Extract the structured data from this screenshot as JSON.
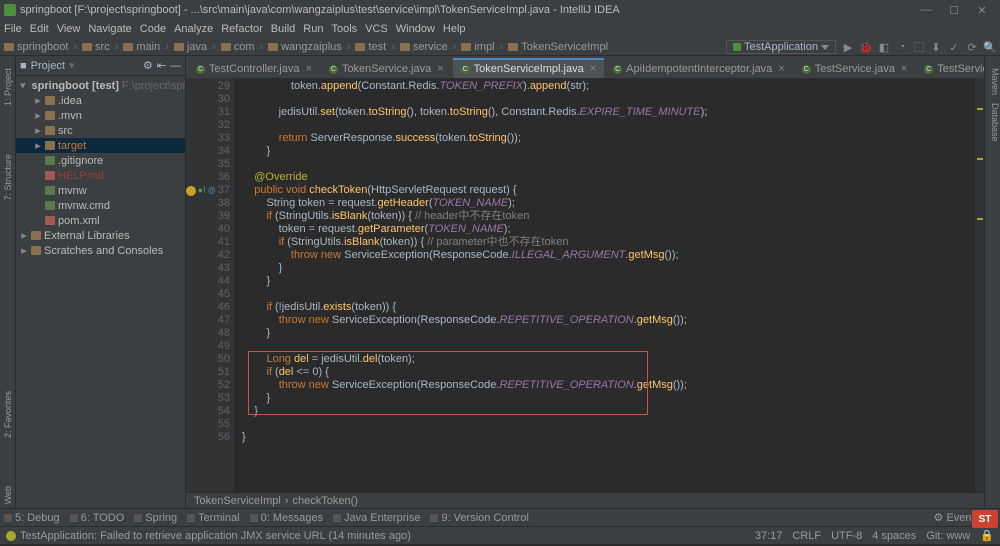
{
  "title": "springboot [F:\\project\\springboot] - ...\\src\\main\\java\\com\\wangzaiplus\\test\\service\\impl\\TokenServiceImpl.java - IntelliJ IDEA",
  "menu": [
    "File",
    "Edit",
    "View",
    "Navigate",
    "Code",
    "Analyze",
    "Refactor",
    "Build",
    "Run",
    "Tools",
    "VCS",
    "Window",
    "Help"
  ],
  "breadcrumb": [
    "springboot",
    "src",
    "main",
    "java",
    "com",
    "wangzaiplus",
    "test",
    "service",
    "impl",
    "TokenServiceImpl"
  ],
  "run_config": "TestApplication",
  "project": {
    "title": "Project",
    "root": {
      "label": "springboot [test]",
      "path": "F:\\project\\springboot"
    },
    "items": [
      {
        "indent": 1,
        "arrow": "▸",
        "icon": "fold",
        "label": ".idea",
        "cls": ""
      },
      {
        "indent": 1,
        "arrow": "▸",
        "icon": "fold",
        "label": ".mvn",
        "cls": ""
      },
      {
        "indent": 1,
        "arrow": "▸",
        "icon": "fold",
        "label": "src",
        "cls": ""
      },
      {
        "indent": 1,
        "arrow": "▸",
        "icon": "fold",
        "label": "target",
        "cls": "orange",
        "sel": true
      },
      {
        "indent": 1,
        "arrow": "",
        "icon": "file",
        "label": ".gitignore",
        "cls": ""
      },
      {
        "indent": 1,
        "arrow": "",
        "icon": "xml",
        "label": "HELP.md",
        "cls": "red"
      },
      {
        "indent": 1,
        "arrow": "",
        "icon": "file",
        "label": "mvnw",
        "cls": ""
      },
      {
        "indent": 1,
        "arrow": "",
        "icon": "file",
        "label": "mvnw.cmd",
        "cls": ""
      },
      {
        "indent": 1,
        "arrow": "",
        "icon": "xml",
        "label": "pom.xml",
        "cls": ""
      }
    ],
    "ext_lib": "External Libraries",
    "scratches": "Scratches and Consoles"
  },
  "tabs": [
    {
      "label": "TestController.java",
      "active": false
    },
    {
      "label": "TokenService.java",
      "active": false
    },
    {
      "label": "TokenServiceImpl.java",
      "active": true
    },
    {
      "label": "ApiIdempotentInterceptor.java",
      "active": false
    },
    {
      "label": "TestService.java",
      "active": false
    },
    {
      "label": "TestServiceImpl.java",
      "active": false
    }
  ],
  "gutter_start": 29,
  "code_lines": [
    {
      "n": 29,
      "t": "                token.append(Constant.Redis.TOKEN_PREFIX).append(str);"
    },
    {
      "n": 30,
      "t": ""
    },
    {
      "n": 31,
      "t": "            jedisUtil.set(token.toString(), token.toString(), Constant.Redis.EXPIRE_TIME_MINUTE);"
    },
    {
      "n": 32,
      "t": ""
    },
    {
      "n": 33,
      "t": "            return ServerResponse.success(token.toString());"
    },
    {
      "n": 34,
      "t": "        }"
    },
    {
      "n": 35,
      "t": ""
    },
    {
      "n": 36,
      "t": "    @Override",
      "ann": true
    },
    {
      "n": 37,
      "t": "    public void checkToken(HttpServletRequest request) {",
      "bulb": true,
      "impl": true
    },
    {
      "n": 38,
      "t": "        String token = request.getHeader(TOKEN_NAME);"
    },
    {
      "n": 39,
      "t": "        if (StringUtils.isBlank(token)) { // header中不存在token"
    },
    {
      "n": 40,
      "t": "            token = request.getParameter(TOKEN_NAME);"
    },
    {
      "n": 41,
      "t": "            if (StringUtils.isBlank(token)) { // parameter中也不存在token"
    },
    {
      "n": 42,
      "t": "                throw new ServiceException(ResponseCode.ILLEGAL_ARGUMENT.getMsg());"
    },
    {
      "n": 43,
      "t": "            }"
    },
    {
      "n": 44,
      "t": "        }"
    },
    {
      "n": 45,
      "t": ""
    },
    {
      "n": 46,
      "t": "        if (!jedisUtil.exists(token)) {"
    },
    {
      "n": 47,
      "t": "            throw new ServiceException(ResponseCode.REPETITIVE_OPERATION.getMsg());"
    },
    {
      "n": 48,
      "t": "        }"
    },
    {
      "n": 49,
      "t": ""
    },
    {
      "n": 50,
      "t": "        Long del = jedisUtil.del(token);"
    },
    {
      "n": 51,
      "t": "        if (del <= 0) {"
    },
    {
      "n": 52,
      "t": "            throw new ServiceException(ResponseCode.REPETITIVE_OPERATION.getMsg());"
    },
    {
      "n": 53,
      "t": "        }"
    },
    {
      "n": 54,
      "t": "    }"
    },
    {
      "n": 55,
      "t": ""
    },
    {
      "n": 56,
      "t": "}"
    }
  ],
  "crumb_bar": [
    "TokenServiceImpl",
    "checkToken()"
  ],
  "bottom_tabs": [
    "5: Debug",
    "6: TODO",
    "Spring",
    "Terminal",
    "0: Messages",
    "Java Enterprise",
    "9: Version Control"
  ],
  "event_log": "Event Log",
  "status_msg": "TestApplication: Failed to retrieve application JMX service URL (14 minutes ago)",
  "status_right": [
    "37:17",
    "CRLF",
    "UTF-8",
    "4 spaces",
    "Git: www"
  ],
  "left_tabs": [
    "1: Project",
    "7: Structure"
  ],
  "left_bottom_tabs": [
    "2: Favorites",
    "Web"
  ],
  "right_tabs": [
    "Maven",
    "Database"
  ]
}
